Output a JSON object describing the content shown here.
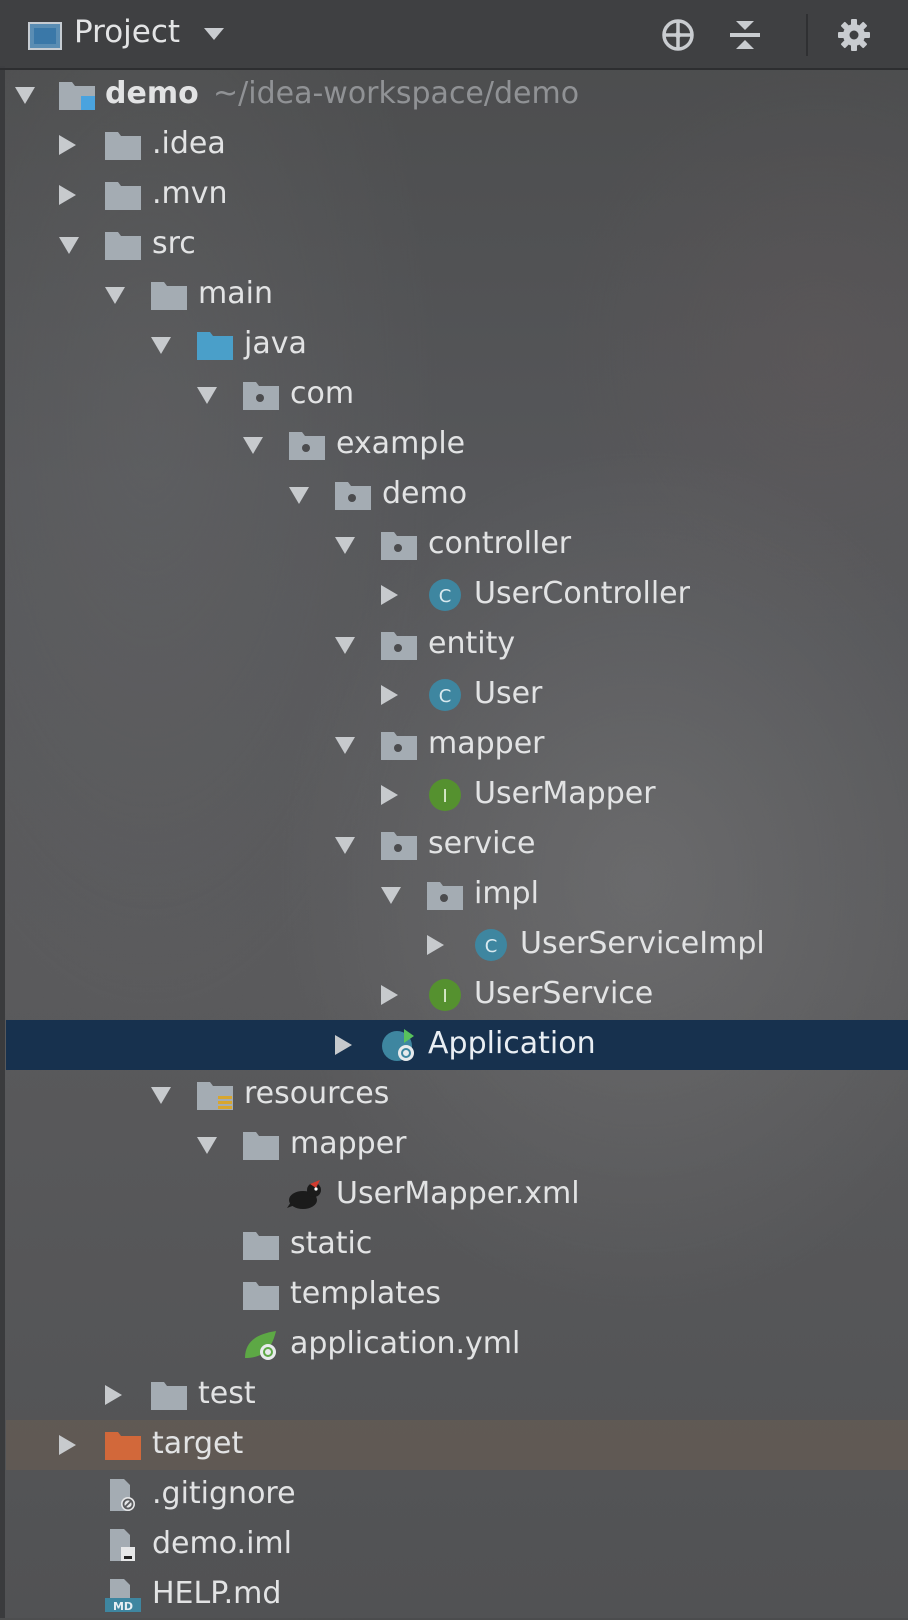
{
  "toolbar": {
    "title": "Project",
    "icons": [
      "project-view-icon",
      "dropdown-caret-icon",
      "locate-target-icon",
      "collapse-all-icon",
      "gear-icon"
    ]
  },
  "root": {
    "label": "demo",
    "path": "~/idea-workspace/demo"
  },
  "tree": [
    {
      "label": ".idea",
      "icon": "folder-icon"
    },
    {
      "label": ".mvn",
      "icon": "folder-icon"
    },
    {
      "label": "src",
      "icon": "folder-icon"
    },
    {
      "label": "main",
      "icon": "folder-icon"
    },
    {
      "label": "java",
      "icon": "source-folder-icon"
    },
    {
      "label": "com",
      "icon": "package-icon"
    },
    {
      "label": "example",
      "icon": "package-icon"
    },
    {
      "label": "demo",
      "icon": "package-icon"
    },
    {
      "label": "controller",
      "icon": "package-icon"
    },
    {
      "label": "UserController",
      "icon": "class-icon"
    },
    {
      "label": "entity",
      "icon": "package-icon"
    },
    {
      "label": "User",
      "icon": "class-icon"
    },
    {
      "label": "mapper",
      "icon": "package-icon"
    },
    {
      "label": "UserMapper",
      "icon": "interface-icon"
    },
    {
      "label": "service",
      "icon": "package-icon"
    },
    {
      "label": "impl",
      "icon": "package-icon"
    },
    {
      "label": "UserServiceImpl",
      "icon": "class-icon"
    },
    {
      "label": "UserService",
      "icon": "interface-icon"
    },
    {
      "label": "Application",
      "icon": "spring-boot-app-icon"
    },
    {
      "label": "resources",
      "icon": "resources-folder-icon"
    },
    {
      "label": "mapper",
      "icon": "folder-icon"
    },
    {
      "label": "UserMapper.xml",
      "icon": "mybatis-bird-icon"
    },
    {
      "label": "static",
      "icon": "folder-icon"
    },
    {
      "label": "templates",
      "icon": "folder-icon"
    },
    {
      "label": "application.yml",
      "icon": "spring-config-icon"
    },
    {
      "label": "test",
      "icon": "folder-icon"
    },
    {
      "label": "target",
      "icon": "excluded-folder-icon"
    },
    {
      "label": ".gitignore",
      "icon": "ignore-file-icon"
    },
    {
      "label": "demo.iml",
      "icon": "iml-file-icon"
    },
    {
      "label": "HELP.md",
      "icon": "markdown-file-icon"
    }
  ],
  "colors": {
    "selection": "#17314e",
    "excluded_row": "#6b5d50",
    "folder": "#a4acb3",
    "source_folder": "#4a9fc9",
    "class_badge": "#3e86a0",
    "interface_badge": "#55912f",
    "excluded_folder": "#d2683a"
  }
}
